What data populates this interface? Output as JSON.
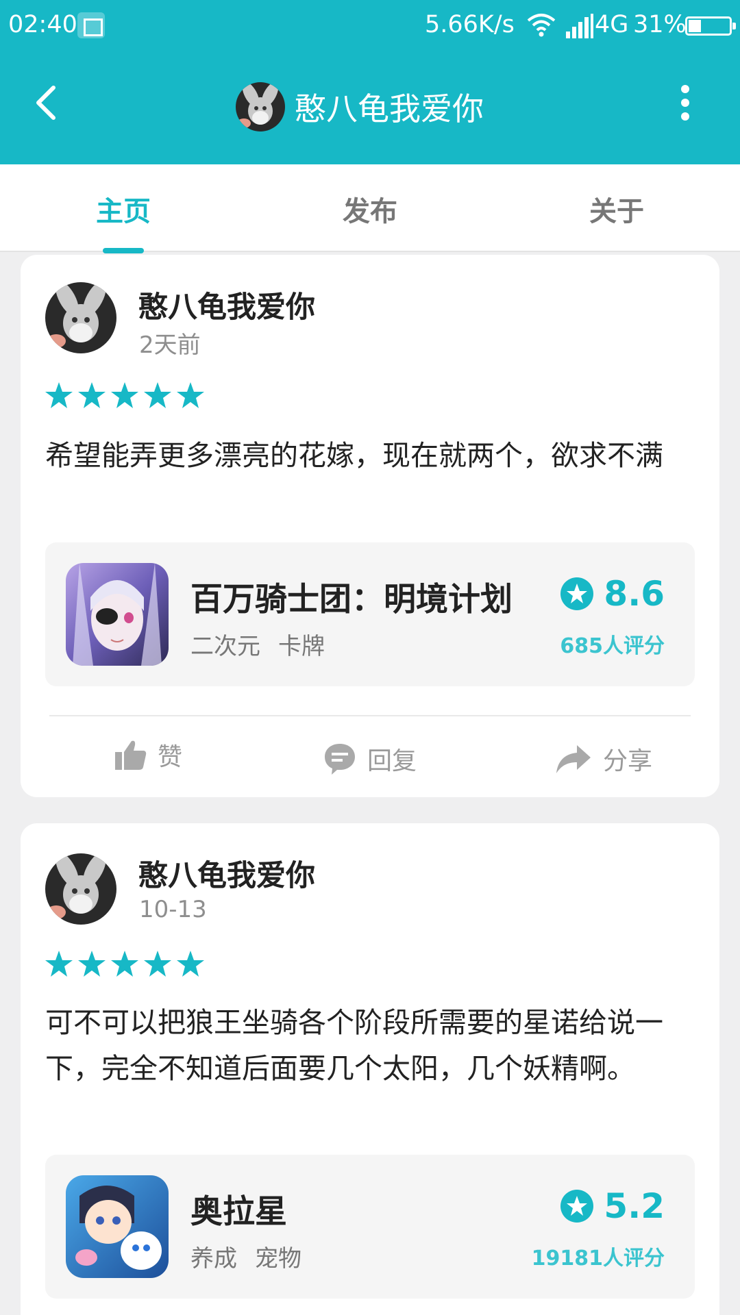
{
  "status_bar": {
    "time": "02:40",
    "network_speed": "5.66K/s",
    "network_type": "4G",
    "battery": "31%",
    "battery_level": 0.31,
    "icons": [
      "screenshot-icon",
      "wifi-icon",
      "signal-icon",
      "battery-icon"
    ]
  },
  "app_bar": {
    "title": "憨八龟我爱你",
    "icons": [
      "back-arrow-icon",
      "avatar",
      "more-vertical-icon"
    ]
  },
  "tabs": [
    {
      "label": "主页",
      "active": true
    },
    {
      "label": "发布",
      "active": false
    },
    {
      "label": "关于",
      "active": false
    }
  ],
  "colors": {
    "accent": "#17b8c6",
    "background": "#efeff0",
    "card": "#ffffff",
    "game_box": "#f5f5f5"
  },
  "reviews": [
    {
      "author": "憨八龟我爱你",
      "time": "2天前",
      "rating": 5,
      "text": "希望能弄更多漂亮的花嫁，现在就两个，欲求不满",
      "game": {
        "name": "百万骑士团：明境计划",
        "tags": [
          "二次元",
          "卡牌"
        ],
        "score": "8.6",
        "rating_count": "685人评分"
      },
      "actions": [
        {
          "label": "赞",
          "icon": "thumbs-up-icon"
        },
        {
          "label": "回复",
          "icon": "comment-icon"
        },
        {
          "label": "分享",
          "icon": "share-icon"
        }
      ]
    },
    {
      "author": "憨八龟我爱你",
      "time": "10-13",
      "rating": 5,
      "text": "可不可以把狼王坐骑各个阶段所需要的星诺给说一下，完全不知道后面要几个太阳，几个妖精啊。",
      "game": {
        "name": "奥拉星",
        "tags": [
          "养成",
          "宠物"
        ],
        "score": "5.2",
        "rating_count": "19181人评分"
      }
    }
  ]
}
